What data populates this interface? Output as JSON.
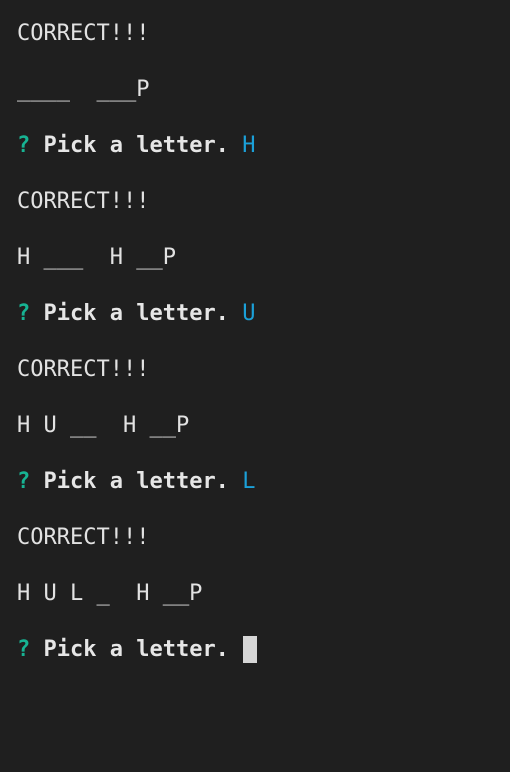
{
  "terminal": {
    "lines": [
      {
        "kind": "output",
        "text": "CORRECT!!!"
      },
      {
        "kind": "output",
        "text": "____  ___P"
      },
      {
        "kind": "prompt",
        "qmark": "?",
        "prompt": "Pick a letter.",
        "answer": "H"
      },
      {
        "kind": "output",
        "text": "CORRECT!!!"
      },
      {
        "kind": "output",
        "text": "H ___  H __P"
      },
      {
        "kind": "prompt",
        "qmark": "?",
        "prompt": "Pick a letter.",
        "answer": "U"
      },
      {
        "kind": "output",
        "text": "CORRECT!!!"
      },
      {
        "kind": "output",
        "text": "H U __  H __P"
      },
      {
        "kind": "prompt",
        "qmark": "?",
        "prompt": "Pick a letter.",
        "answer": "L"
      },
      {
        "kind": "output",
        "text": "CORRECT!!!"
      },
      {
        "kind": "output",
        "text": "H U L _  H __P"
      },
      {
        "kind": "prompt",
        "qmark": "?",
        "prompt": "Pick a letter.",
        "answer": ""
      }
    ],
    "colors": {
      "background": "#1f1f1f",
      "text": "#e2e2e2",
      "qmark": "#17b393",
      "answer": "#1ba0d8",
      "cursor": "#d6d6d6"
    }
  }
}
